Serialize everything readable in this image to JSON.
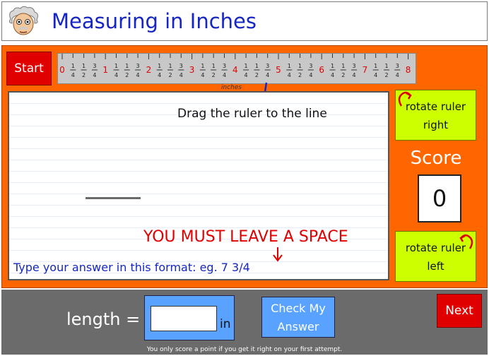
{
  "header": {
    "title": "Measuring in Inches"
  },
  "buttons": {
    "start": "Start",
    "rotate_right": "rotate ruler right",
    "rotate_left": "rotate ruler left",
    "check": "Check My Answer",
    "next": "Next"
  },
  "ruler": {
    "unit_label": "inches",
    "inch_numbers": [
      "0",
      "1",
      "2",
      "3",
      "4",
      "5",
      "6",
      "7",
      "8"
    ],
    "fraction_marks": [
      "1/4",
      "1/2",
      "3/4"
    ]
  },
  "workspace": {
    "instruction": "Drag the ruler to the line",
    "space_warning": "YOU MUST LEAVE A SPACE",
    "format_hint": "Type your answer in this format:  eg. 7 3/4"
  },
  "score": {
    "label": "Score",
    "value": "0"
  },
  "answer": {
    "label": "length =",
    "unit": "in",
    "value": "",
    "placeholder": ""
  },
  "footer": {
    "note": "You only score a point if you get it right on your first attempt."
  },
  "colors": {
    "stage": "#ff6600",
    "title": "#1526c4",
    "red_button": "#e00000",
    "lime_button": "#ccff00",
    "blue_button": "#5aa2ff",
    "bottom_bar": "#6b6b6b"
  },
  "icons": {
    "mascot": "einstein-mascot",
    "rotate_right": "rotate-clockwise-arrow-icon",
    "rotate_left": "rotate-counterclockwise-arrow-icon",
    "pointer": "down-arrow-icon"
  }
}
